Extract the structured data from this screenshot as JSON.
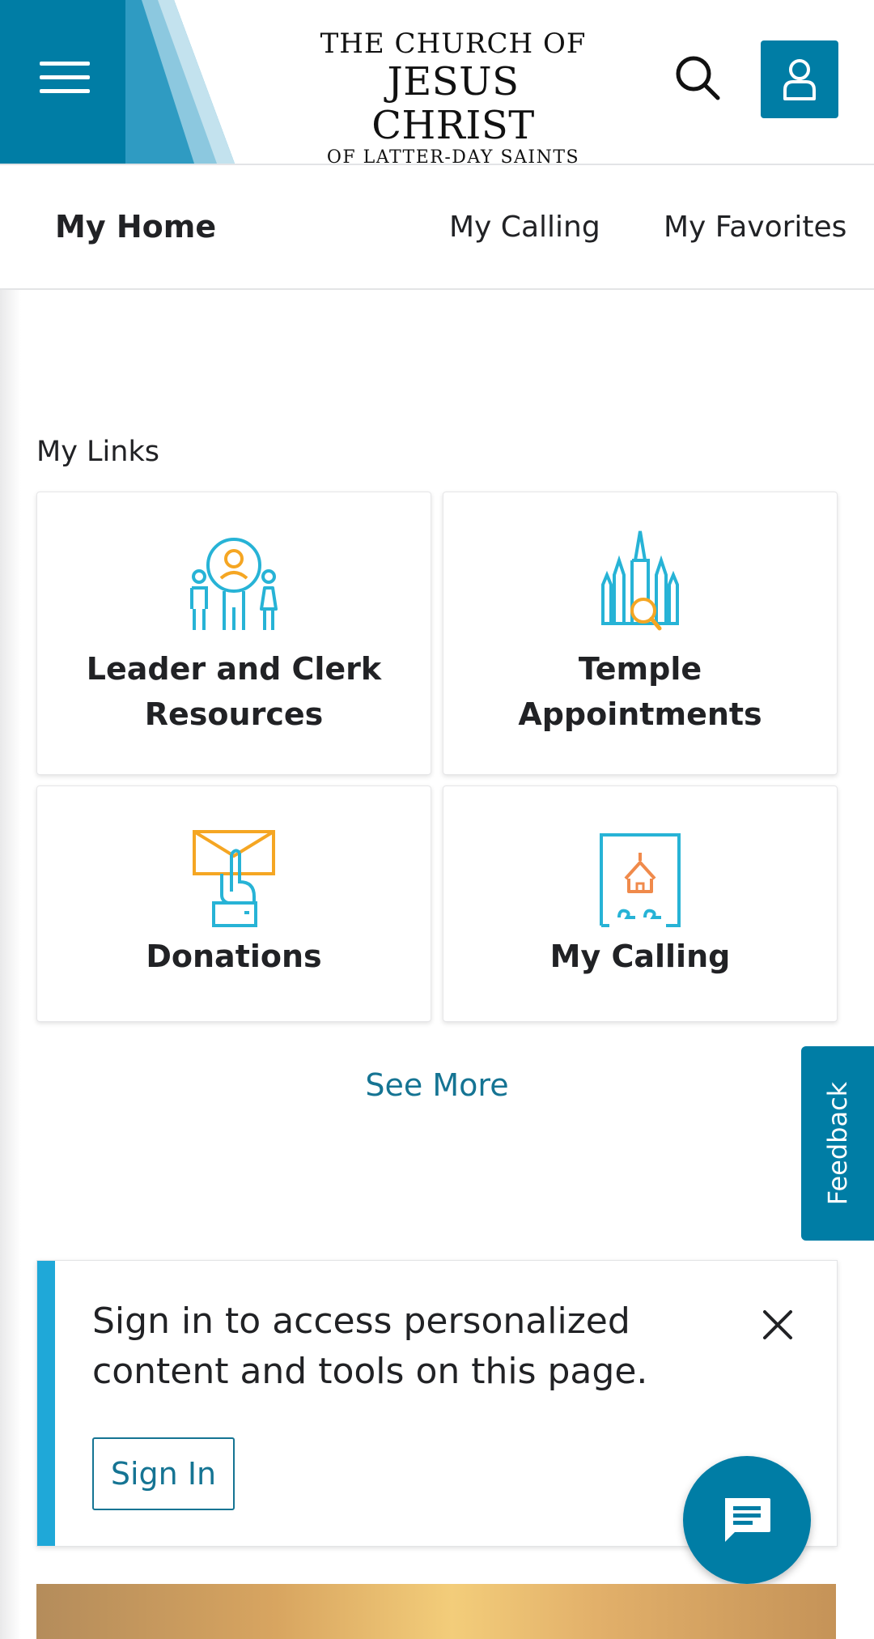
{
  "header": {
    "logo_line1": "THE CHURCH OF",
    "logo_line2": "JESUS CHRIST",
    "logo_line3": "OF LATTER-DAY SAINTS",
    "menu_icon": "hamburger-icon",
    "search_icon": "search-icon",
    "account_icon": "user-icon",
    "brand_color": "#007da5"
  },
  "tabs": [
    {
      "label": "My Home",
      "active": true
    },
    {
      "label": "My Calling",
      "active": false
    },
    {
      "label": "My Favorites",
      "active": false
    }
  ],
  "links": {
    "title": "My Links",
    "cards": [
      {
        "line1": "Leader and Clerk",
        "line2": "Resources",
        "icon": "leader-clerk-icon"
      },
      {
        "line1": "Temple",
        "line2": "Appointments",
        "icon": "temple-search-icon"
      },
      {
        "line1": "Donations",
        "icon": "donations-icon"
      },
      {
        "line1": "My Calling",
        "icon": "calling-icon"
      }
    ],
    "see_more": "See More"
  },
  "feedback": {
    "label": "Feedback"
  },
  "notice": {
    "line1": "Sign in to access personalized",
    "line2": "content and tools on this page.",
    "button": "Sign In",
    "accent": "#1fa8d8"
  },
  "chat": {
    "icon": "chat-icon"
  }
}
